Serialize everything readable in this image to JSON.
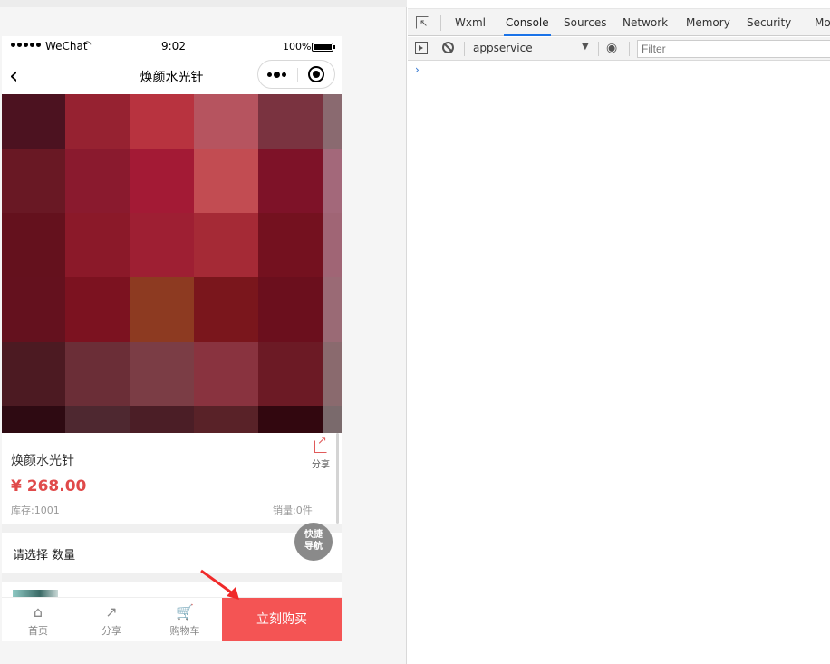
{
  "status_bar": {
    "carrier": "WeChat",
    "time": "9:02",
    "battery": "100%"
  },
  "nav": {
    "title": "焕颜水光针"
  },
  "product": {
    "name": "焕颜水光针",
    "price": "¥ 268.00",
    "stock": "库存:1001",
    "sales": "销量:0件",
    "share_label": "分享",
    "pixel_colors": [
      [
        "#4c1220",
        "#962231",
        "#b8333f",
        "#b6545f",
        "#7a3340",
        "#8a6a70"
      ],
      [
        "#691824",
        "#8a1a2e",
        "#a31a35",
        "#c24c52",
        "#7e1228",
        "#a3687a"
      ],
      [
        "#64111d",
        "#8b1929",
        "#9e1f33",
        "#a52a36",
        "#74111f",
        "#a06575"
      ],
      [
        "#64111e",
        "#7c1220",
        "#8d3a21",
        "#7a161c",
        "#6b0f1d",
        "#9a6a75"
      ],
      [
        "#4c1a22",
        "#6b2e37",
        "#7b3d45",
        "#89333f",
        "#6c1a25",
        "#8a6a6e"
      ],
      [
        "#2e0a12",
        "#4e2830",
        "#4b1e26",
        "#592228",
        "#32070f",
        "#7a6a6c"
      ]
    ]
  },
  "spec": {
    "label": "请选择 数量"
  },
  "quick_nav": {
    "line1": "快捷",
    "line2": "导航"
  },
  "tabbar": {
    "items": [
      {
        "label": "首页",
        "icon": "⌂"
      },
      {
        "label": "分享",
        "icon": "↗"
      },
      {
        "label": "购物车",
        "icon": "🛒"
      }
    ],
    "buy_label": "立刻购买"
  },
  "devtools": {
    "tabs": [
      "Wxml",
      "Console",
      "Sources",
      "Network",
      "Memory",
      "Security",
      "Mo"
    ],
    "active_tab": "Console",
    "context": "appservice",
    "filter_placeholder": "Filter",
    "prompt": "›"
  }
}
